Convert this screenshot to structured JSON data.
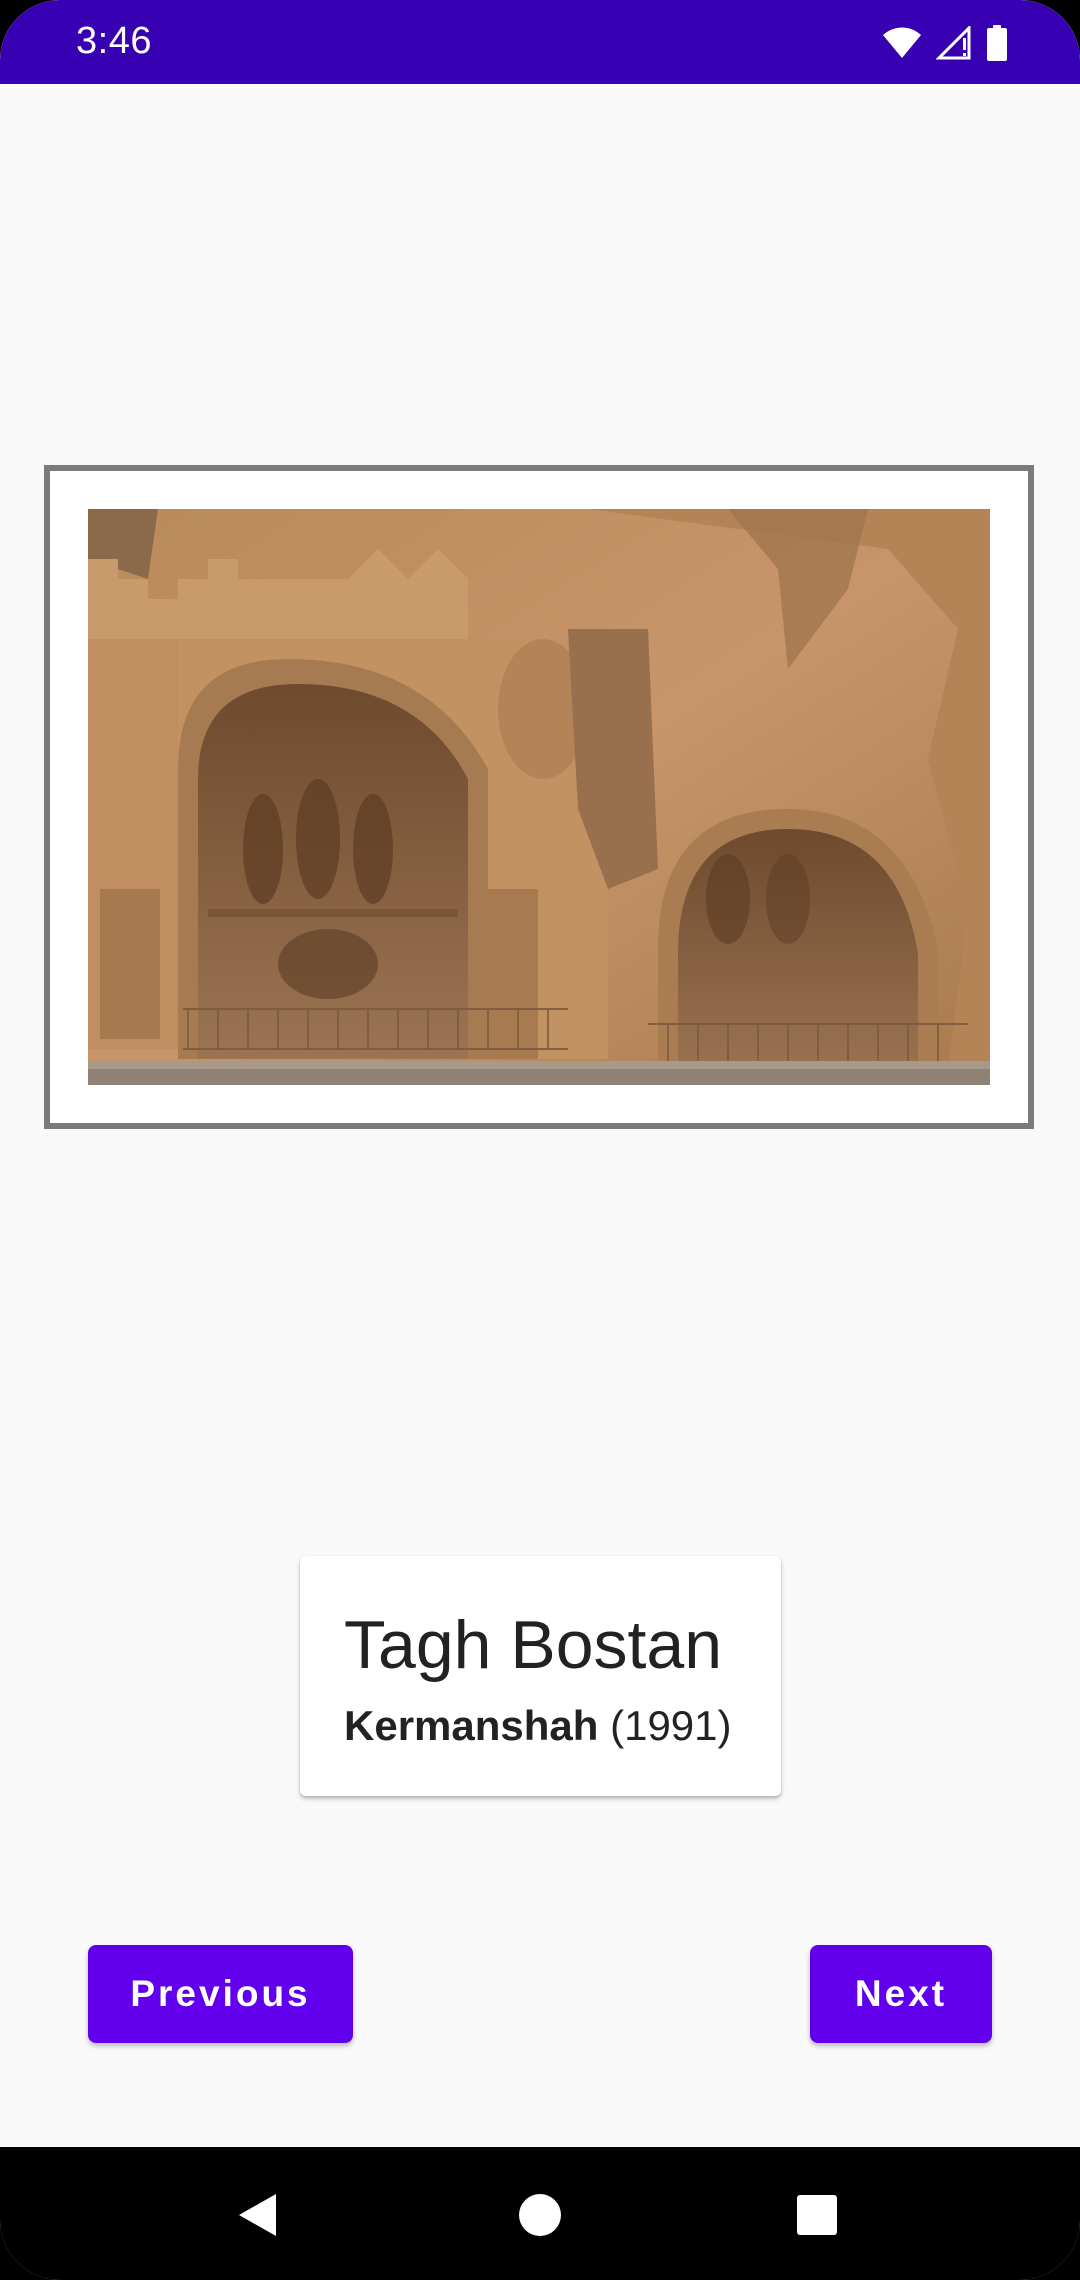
{
  "status_bar": {
    "time": "3:46",
    "icons": [
      "wifi-icon",
      "cell-signal-icon",
      "battery-icon"
    ],
    "background": "#3700b3"
  },
  "artwork": {
    "image_description_icon": "photo-image",
    "title": "Tagh Bostan",
    "artist": "Kermanshah",
    "year": "(1991)"
  },
  "buttons": {
    "previous_label": "Previous",
    "next_label": "Next",
    "color": "#6200ee"
  },
  "nav_bar": {
    "icons": [
      "back-icon",
      "home-icon",
      "recents-icon"
    ]
  }
}
